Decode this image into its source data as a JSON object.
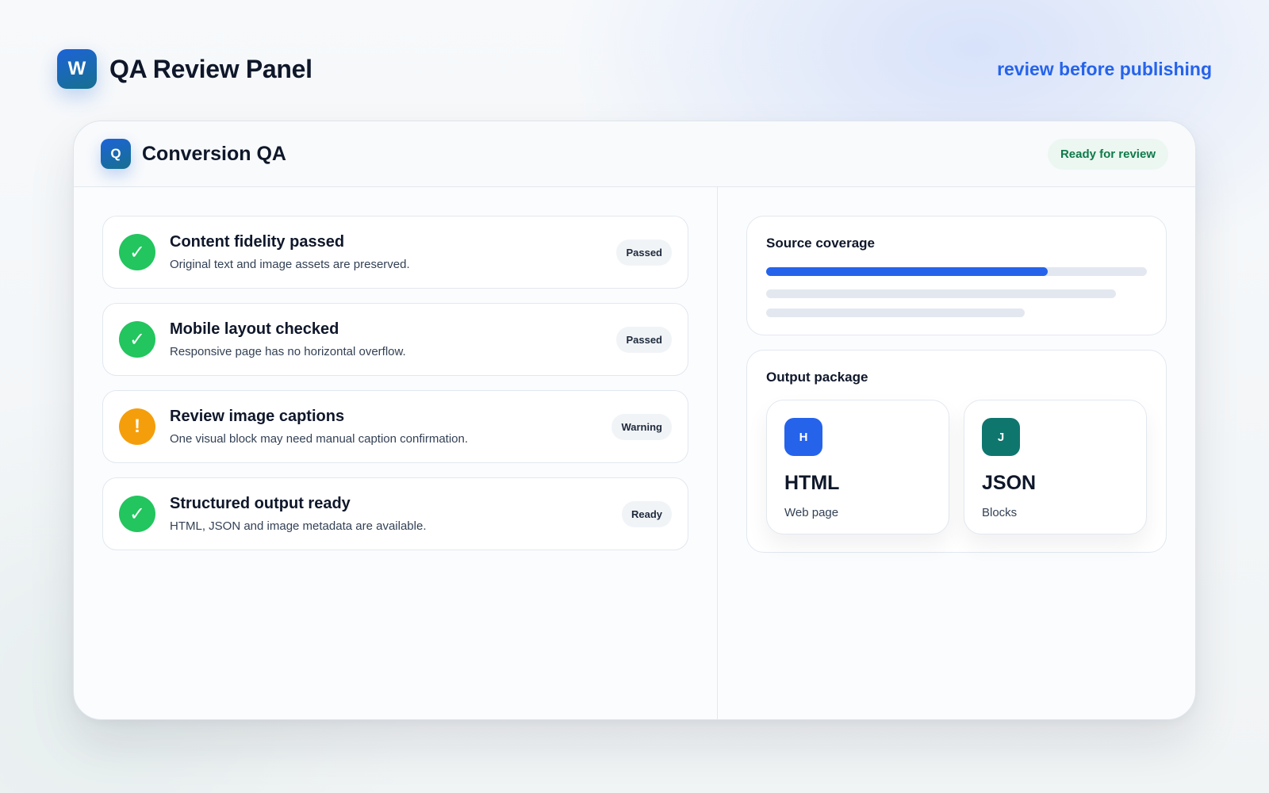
{
  "header": {
    "logo_letter": "W",
    "title": "QA Review Panel",
    "tagline": "review before publishing"
  },
  "panel": {
    "logo_letter": "Q",
    "title": "Conversion QA",
    "status_badge": "Ready for review"
  },
  "checks": [
    {
      "icon": "check-icon",
      "glyph": "✓",
      "state": "ok",
      "title": "Content fidelity passed",
      "description": "Original text and image assets are preserved.",
      "status": "Passed"
    },
    {
      "icon": "check-icon",
      "glyph": "✓",
      "state": "ok",
      "title": "Mobile layout checked",
      "description": "Responsive page has no horizontal overflow.",
      "status": "Passed"
    },
    {
      "icon": "warning-icon",
      "glyph": "!",
      "state": "warn",
      "title": "Review image captions",
      "description": "One visual block may need manual caption confirmation.",
      "status": "Warning"
    },
    {
      "icon": "check-icon",
      "glyph": "✓",
      "state": "ok",
      "title": "Structured output ready",
      "description": "HTML, JSON and image metadata are available.",
      "status": "Ready"
    }
  ],
  "coverage": {
    "title": "Source coverage",
    "progress": 0.74
  },
  "output_package": {
    "title": "Output package",
    "items": [
      {
        "badge": "H",
        "name": "HTML",
        "subtitle": "Web page",
        "color": "#2563eb"
      },
      {
        "badge": "J",
        "name": "JSON",
        "subtitle": "Blocks",
        "color": "#0f766e"
      }
    ]
  },
  "colors": {
    "accent": "#2563eb",
    "success": "#22c55e",
    "warning": "#f59e0b",
    "ready_text": "#0f7a4a"
  }
}
